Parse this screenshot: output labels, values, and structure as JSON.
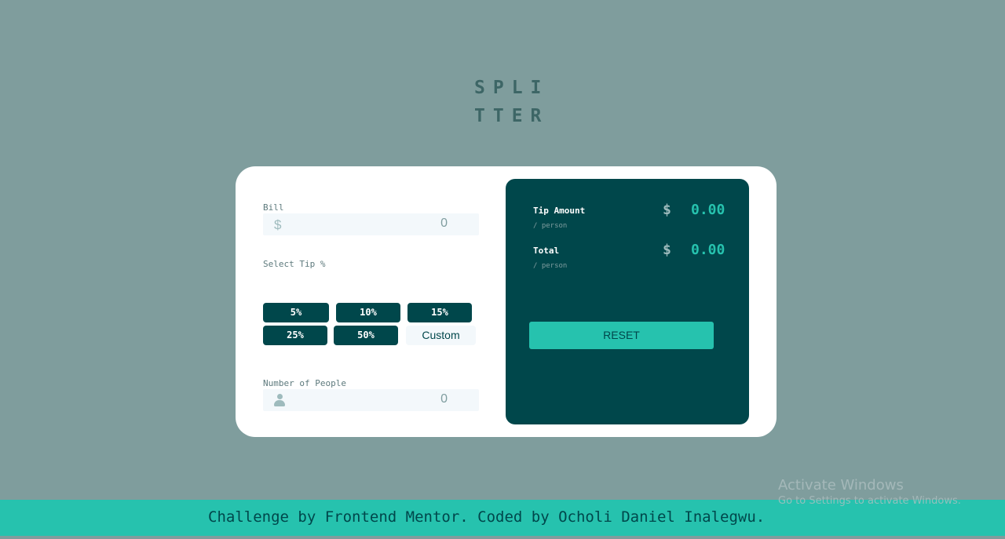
{
  "logo": {
    "line1": "SPLI",
    "line2": "TTER"
  },
  "form": {
    "bill_label": "Bill",
    "bill_currency": "$",
    "bill_placeholder": "0",
    "tip_label": "Select Tip %",
    "tips": [
      "5%",
      "10%",
      "15%",
      "25%",
      "50%"
    ],
    "custom_label": "Custom",
    "people_label": "Number of People",
    "people_placeholder": "0"
  },
  "results": {
    "tip_amount_label": "Tip Amount",
    "tip_amount_sub": "/ person",
    "tip_amount_currency": "$",
    "tip_amount_value": "0.00",
    "total_label": "Total",
    "total_sub": "/ person",
    "total_currency": "$",
    "total_value": "0.00",
    "reset_label": "RESET"
  },
  "footer": {
    "text": "Challenge by Frontend Mentor. Coded by Ocholi Daniel Inalegwu."
  },
  "watermark": {
    "title": "Activate Windows",
    "subtitle": "Go to Settings to activate Windows."
  },
  "icons": {
    "bill": "dollar-icon",
    "people": "person-icon"
  },
  "colors": {
    "background": "#7f9d9d",
    "card": "#ffffff",
    "dark_cyan": "#00474b",
    "accent": "#26c2ae",
    "input_bg": "#f3f8fb"
  }
}
